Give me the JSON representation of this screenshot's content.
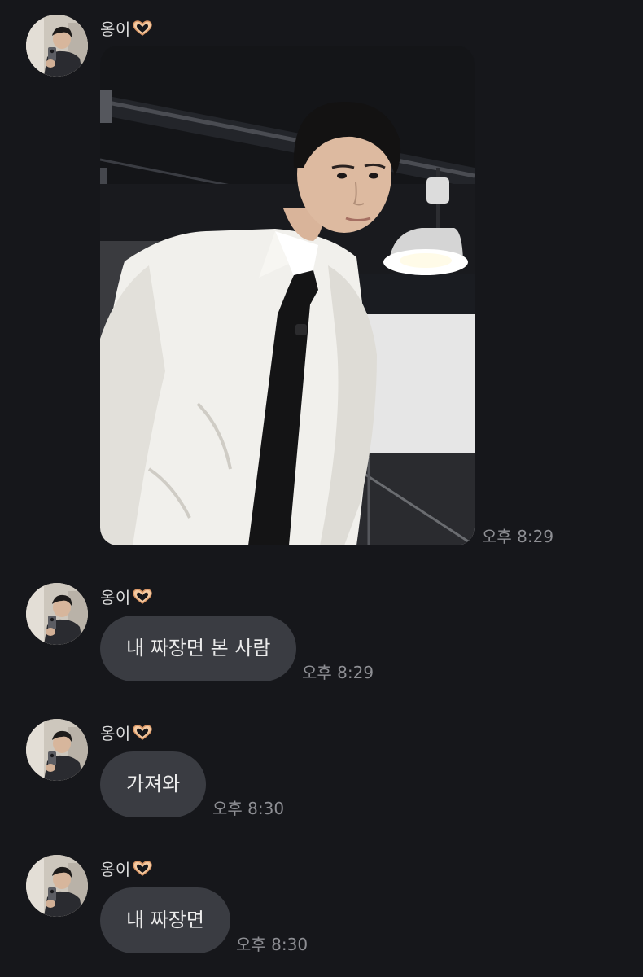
{
  "messages": [
    {
      "sender": "옹이",
      "type": "image",
      "time": "오후 8:29"
    },
    {
      "sender": "옹이",
      "type": "text",
      "text": "내 짜장면 본 사람",
      "time": "오후 8:29"
    },
    {
      "sender": "옹이",
      "type": "text",
      "text": "가져와",
      "time": "오후 8:30"
    },
    {
      "sender": "옹이",
      "type": "text",
      "text": "내 짜장면",
      "time": "오후 8:30"
    }
  ],
  "colors": {
    "background": "#16171b",
    "bubble": "#3a3c42",
    "timestamp": "#8e8f94"
  },
  "icons": {
    "sender_suffix": "heart-hands-icon"
  }
}
